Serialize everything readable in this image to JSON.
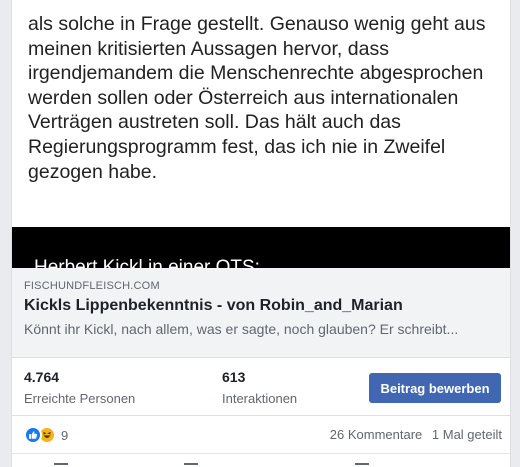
{
  "quote": {
    "lines": [
      "als solche in Frage gestellt. Genauso wenig geht aus",
      "meinen kritisierten Aussagen hervor, dass",
      "irgendjemandem die Menschenrechte abgesprochen",
      "werden sollen oder Österreich aus internationalen",
      "Verträgen austreten soll. Das hält auch das",
      "Regierungsprogramm fest, das ich nie in Zweifel",
      "gezogen habe."
    ],
    "video_caption": "Herbert Kickl in einer OTS:"
  },
  "link_preview": {
    "domain": "FISCHUNDFLEISCH.COM",
    "title": "Kickls Lippenbekenntnis - von Robin_and_Marian",
    "description": "Könnt ihr Kickl, nach allem, was er sagte, noch glauben? Er schreibt..."
  },
  "stats": {
    "reach_value": "4.764",
    "reach_label": "Erreichte Personen",
    "interactions_value": "613",
    "interactions_label": "Interaktionen",
    "boost_label": "Beitrag bewerben"
  },
  "engagement": {
    "reaction_icons": [
      "like-icon",
      "haha-icon"
    ],
    "reaction_count": "9",
    "comments": "26 Kommentare",
    "shares": "1 Mal geteilt"
  },
  "colors": {
    "boost_button": "#4267b2",
    "like_reaction": "#1877f2",
    "haha_reaction": "#f7b125",
    "link_preview_bg": "#f2f3f5"
  }
}
